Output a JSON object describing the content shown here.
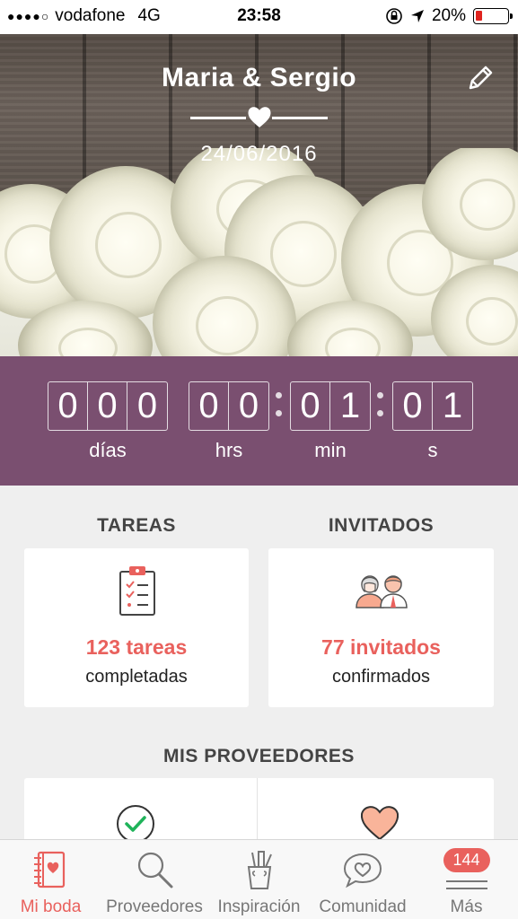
{
  "status_bar": {
    "signal_dots": "●●●●○",
    "carrier": "vodafone",
    "network": "4G",
    "time": "23:58",
    "battery_text": "20%",
    "battery_level": 0.2,
    "battery_color": "#e0241f"
  },
  "header": {
    "couple_names": "Maria & Sergio",
    "wedding_date": "24/06/2016"
  },
  "countdown": {
    "days": [
      "0",
      "0",
      "0"
    ],
    "hours": [
      "0",
      "0"
    ],
    "minutes": [
      "0",
      "1"
    ],
    "seconds": [
      "0",
      "1"
    ],
    "labels": {
      "days": "días",
      "hours": "hrs",
      "minutes": "min",
      "seconds": "s"
    },
    "background": "#7a4f70"
  },
  "tareas": {
    "title": "TAREAS",
    "count": "123 tareas",
    "sub": "completadas",
    "icon": "clipboard-checklist-icon"
  },
  "invitados": {
    "title": "INVITADOS",
    "count": "77 invitados",
    "sub": "confirmados",
    "icon": "guests-icon"
  },
  "proveedores": {
    "title": "MIS PROVEEDORES",
    "cards": [
      {
        "icon": "check-circle-icon"
      },
      {
        "icon": "heart-icon"
      }
    ]
  },
  "tabbar": {
    "tabs": [
      {
        "label": "Mi boda",
        "icon": "notebook-icon",
        "active": true
      },
      {
        "label": "Proveedores",
        "icon": "search-icon",
        "active": false
      },
      {
        "label": "Inspiración",
        "icon": "pencil-cup-icon",
        "active": false
      },
      {
        "label": "Comunidad",
        "icon": "chat-heart-icon",
        "active": false
      },
      {
        "label": "Más",
        "icon": "menu-icon",
        "active": false,
        "badge": "144"
      }
    ]
  },
  "colors": {
    "accent": "#e9615d",
    "plum": "#7a4f70"
  }
}
